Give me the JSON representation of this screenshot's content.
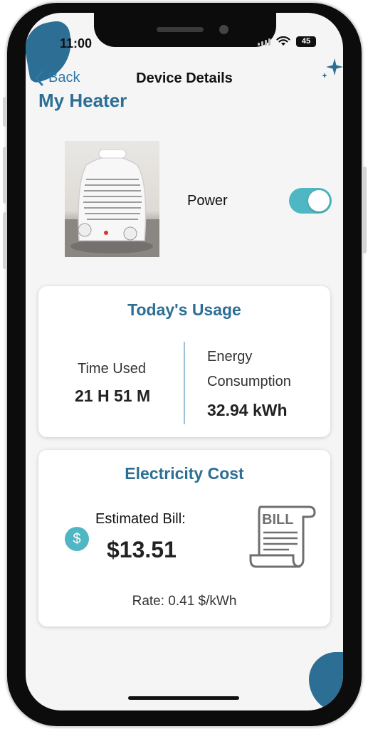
{
  "status_bar": {
    "time": "11:00",
    "battery": "45"
  },
  "nav": {
    "back_label": "Back",
    "title": "Device Details"
  },
  "device": {
    "name": "My Heater",
    "power_label": "Power",
    "power_on": true
  },
  "usage": {
    "title": "Today's Usage",
    "time_used_label": "Time Used",
    "time_used_value": "21 H 51 M",
    "energy_label_line1": "Energy",
    "energy_label_line2": "Consumption",
    "energy_value": "32.94 kWh"
  },
  "cost": {
    "title": "Electricity Cost",
    "currency_symbol": "$",
    "estimated_label": "Estimated Bill:",
    "estimated_value": "$13.51",
    "bill_icon_text": "BILL",
    "rate": "Rate: 0.41 $/kWh"
  },
  "icons": {
    "back": "chevron-left-icon",
    "sparkle": "sparkle-icon",
    "dollar": "dollar-icon",
    "bill": "bill-receipt-icon",
    "wifi": "wifi-icon",
    "signal": "signal-icon"
  },
  "colors": {
    "accent": "#2c6e94",
    "link": "#2f77a6",
    "toggle_on": "#4fb7c3",
    "background": "#f5f5f5"
  }
}
